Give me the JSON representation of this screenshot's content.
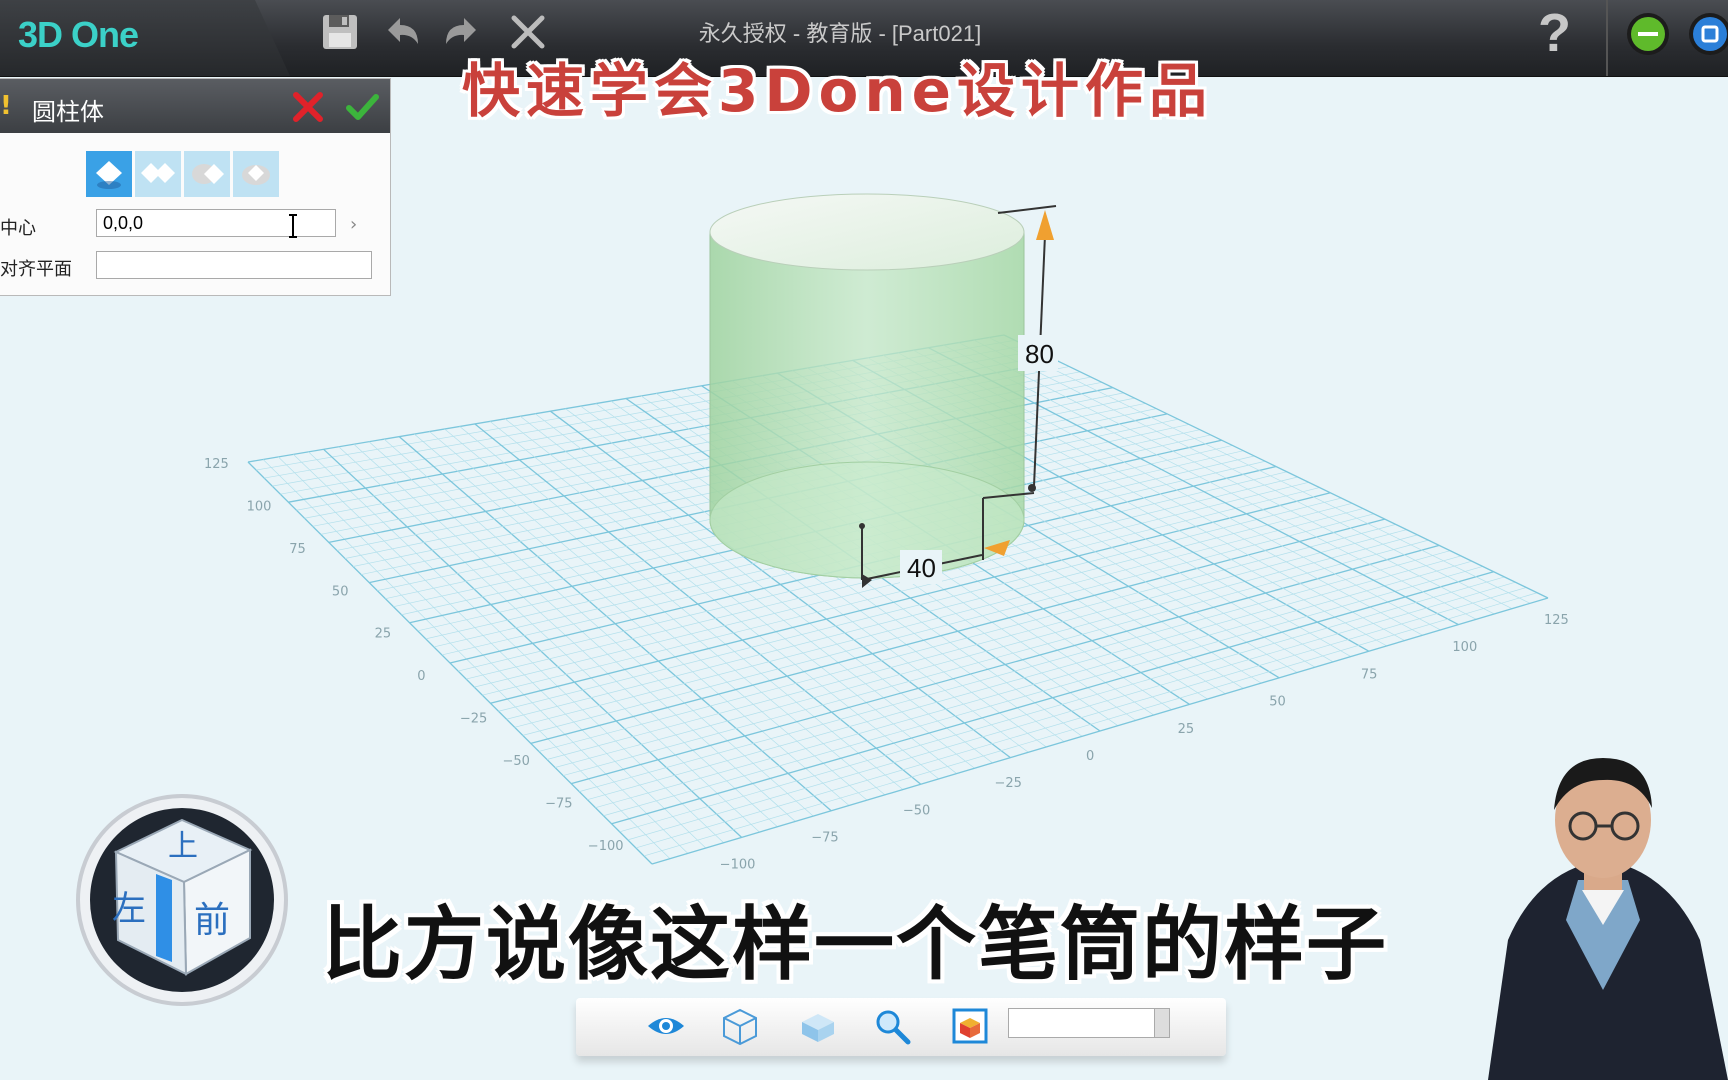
{
  "app": {
    "logo": "3D One",
    "window_title": "永久授权  - 教育版 - [Part021]",
    "help_label": "?"
  },
  "captions": {
    "top": "快速学会3Done设计作品",
    "bottom": "比方说像这样一个笔筒的样子"
  },
  "panel": {
    "title": "圆柱体",
    "warning": "!",
    "center_label": "中心",
    "center_value": "0,0,0",
    "align_label": "对齐平面",
    "align_value": ""
  },
  "dimensions": {
    "height": "80",
    "radius": "40"
  },
  "grid_ticks": {
    "left": [
      "125",
      "100",
      "75",
      "50",
      "25",
      "0",
      "−25",
      "−50",
      "−75",
      "−100"
    ],
    "front": [
      "−100",
      "−75",
      "−50",
      "−25",
      "0",
      "25",
      "50",
      "75",
      "100",
      "125"
    ]
  },
  "viewcube": {
    "top": "上",
    "front": "前",
    "left": "左"
  },
  "colors": {
    "accent": "#3aa1e6",
    "cylinder": "#a8d8a8",
    "grid": "#8fd0e0",
    "dimension_arrow": "#f0a030"
  }
}
